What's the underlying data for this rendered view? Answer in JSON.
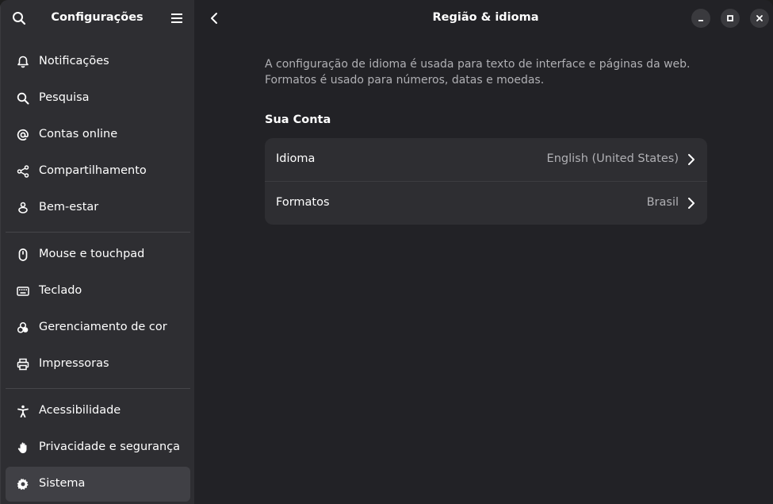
{
  "sidebar": {
    "title": "Configurações",
    "items": [
      {
        "label": "Notificações",
        "icon": "bell-icon"
      },
      {
        "label": "Pesquisa",
        "icon": "search-icon"
      },
      {
        "label": "Contas online",
        "icon": "at-sign-icon"
      },
      {
        "label": "Compartilhamento",
        "icon": "share-icon"
      },
      {
        "label": "Bem-estar",
        "icon": "wellbeing-icon"
      },
      {
        "label": "Mouse e touchpad",
        "icon": "mouse-icon"
      },
      {
        "label": "Teclado",
        "icon": "keyboard-icon"
      },
      {
        "label": "Gerenciamento de cor",
        "icon": "color-management-icon"
      },
      {
        "label": "Impressoras",
        "icon": "printer-icon"
      },
      {
        "label": "Acessibilidade",
        "icon": "accessibility-icon"
      },
      {
        "label": "Privacidade e segurança",
        "icon": "hand-icon"
      },
      {
        "label": "Sistema",
        "icon": "gear-icon"
      }
    ],
    "active_item": "Sistema"
  },
  "header": {
    "title": "Região & idioma"
  },
  "main": {
    "description_line1": "A configuração de idioma é usada para texto de interface e páginas da web.",
    "description_line2": "Formatos é usado para números, datas e moedas.",
    "section_title": "Sua Conta",
    "rows": [
      {
        "label": "Idioma",
        "value": "English (United States)"
      },
      {
        "label": "Formatos",
        "value": "Brasil"
      }
    ]
  },
  "colors": {
    "sidebar_bg": "#2e2e32",
    "main_bg": "#222226",
    "active_item_bg": "#404045",
    "card_bg": "#2e2e32",
    "secondary_text": "#b0b0b4"
  }
}
